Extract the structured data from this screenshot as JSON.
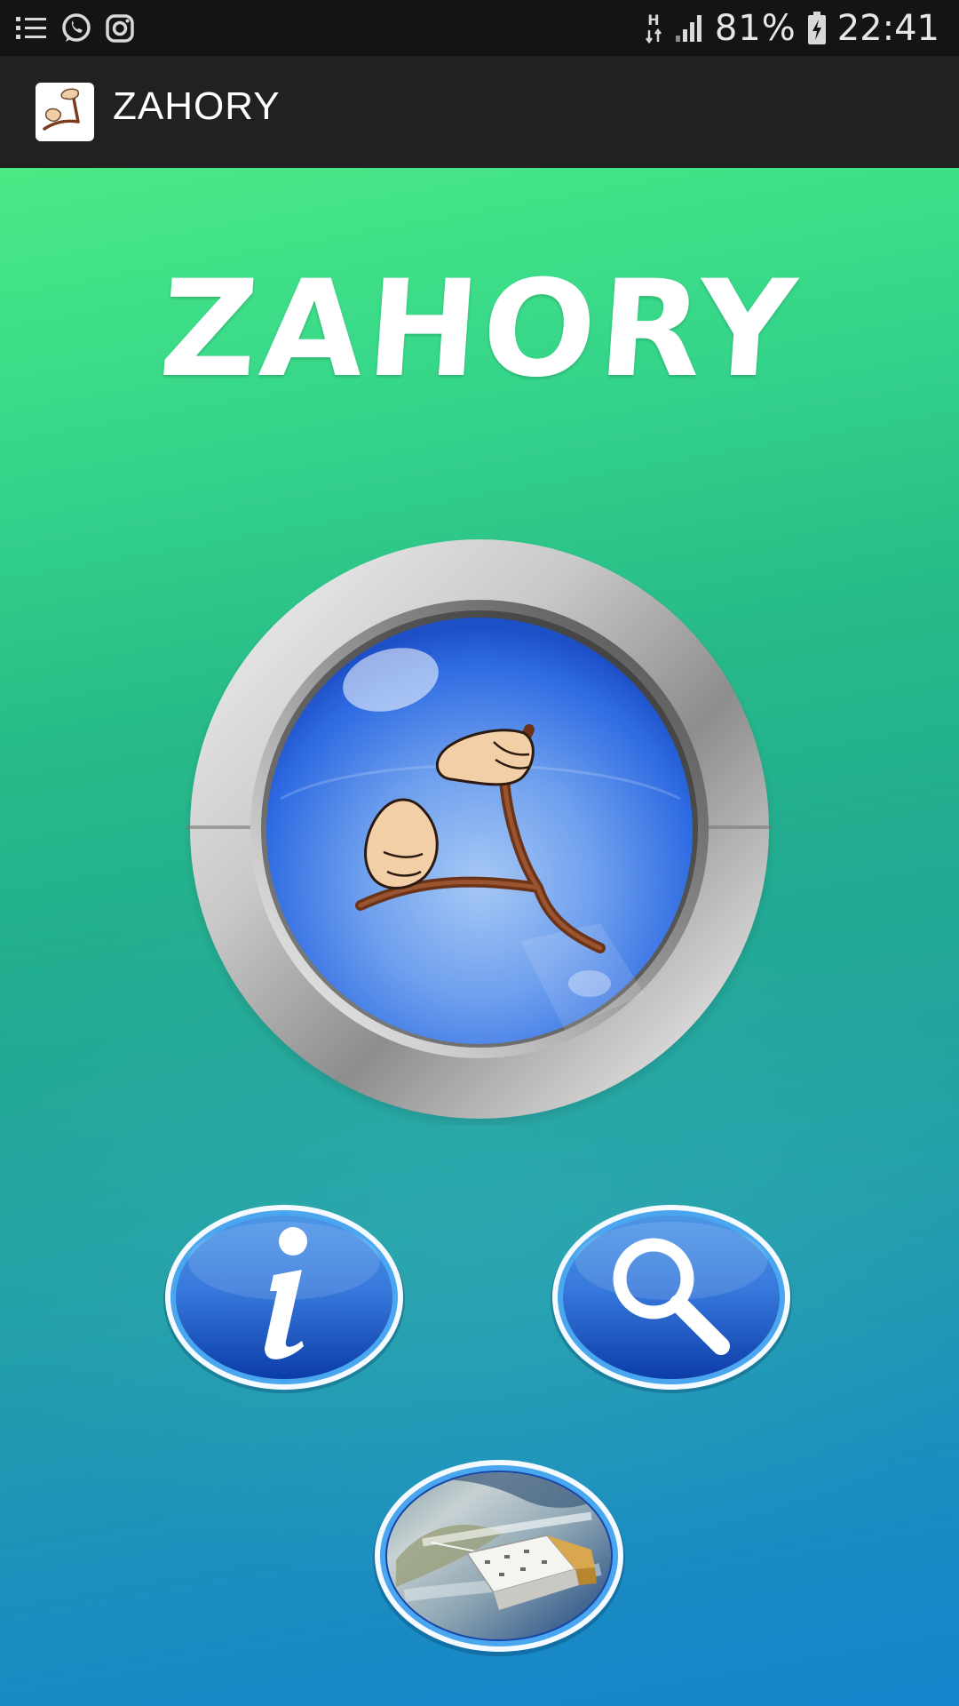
{
  "status_bar": {
    "notification_icons": [
      "list-icon",
      "whatsapp-icon",
      "instagram-icon"
    ],
    "network_type": "H",
    "battery_percent": "81%",
    "time": "22:41"
  },
  "action_bar": {
    "title": "ZAHORY",
    "icon": "divining-rod-icon"
  },
  "main": {
    "logo": {
      "text_main": "ZAHOR",
      "text_last": "Y"
    },
    "buttons": {
      "dowse": "divining-rod-icon",
      "info": "info-icon",
      "search": "search-icon",
      "satellite": "satellite-icon"
    }
  },
  "colors": {
    "status_bar": "#141414",
    "action_bar": "#212121",
    "gradient_top": "#4aea86",
    "gradient_bottom": "#1484cc",
    "button_blue": "#2f6fe0",
    "rod_brown": "#7a3b1f"
  }
}
